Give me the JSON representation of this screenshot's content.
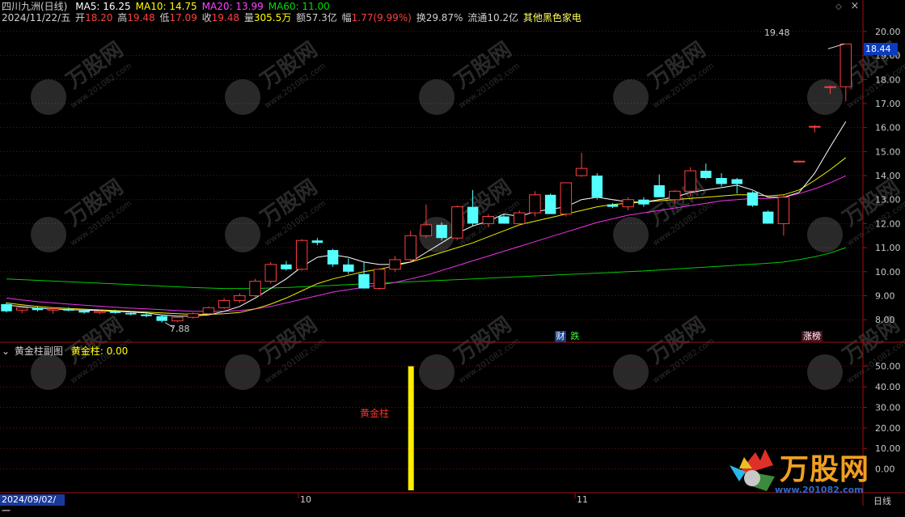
{
  "window": {
    "title": "四川九洲(日线)",
    "period_label": "日线"
  },
  "ma_legend": [
    {
      "label": "MA5: 16.25",
      "color": "#ffffff"
    },
    {
      "label": "MA10: 14.75",
      "color": "#ffff00"
    },
    {
      "label": "MA20: 13.99",
      "color": "#ff44ff"
    },
    {
      "label": "MA60: 11.00",
      "color": "#00dd00"
    }
  ],
  "quote": {
    "date": "2024/11/22/五",
    "open_label": "开",
    "open": "18.20",
    "high_label": "高",
    "high": "19.48",
    "low_label": "低",
    "low": "17.09",
    "close_label": "收",
    "close": "19.48",
    "vol_label": "量",
    "vol": "305.5万",
    "amount_label": "额",
    "amount": "57.3亿",
    "chg_label": "幅",
    "chg": "1.77(9.99%)",
    "turnover_label": "换",
    "turnover": "29.87%",
    "float_label": "流通",
    "float": "10.2亿",
    "sector": "其他黑色家电"
  },
  "price_axis": {
    "min": 7.5,
    "max": 20.3,
    "ticks": [
      "20.00",
      "19.00",
      "18.00",
      "17.00",
      "16.00",
      "15.00",
      "14.00",
      "13.00",
      "12.00",
      "11.00",
      "10.00",
      "9.00",
      "8.00"
    ],
    "current": "18.44",
    "high_note": "19.48",
    "low_note": "7.88"
  },
  "date_axis": {
    "start": "2024/09/02/一",
    "ticks": [
      "10",
      "11"
    ]
  },
  "markers": {
    "cai": "财",
    "die": "跌",
    "zhangting": "涨榜"
  },
  "sub_chart": {
    "title": "黄金柱副图",
    "indicator_label": "黄金柱: 0.00",
    "bar_label": "黄金柱",
    "ticks": [
      "50.00",
      "40.00",
      "30.00",
      "20.00",
      "10.00",
      "0.00"
    ],
    "min": -10,
    "max": 55
  },
  "watermark": {
    "brand": "万股网",
    "url": "www.201082.com"
  },
  "chart_data": {
    "type": "candlestick",
    "ohlc": [
      [
        8.65,
        8.72,
        8.3,
        8.35
      ],
      [
        8.4,
        8.55,
        8.28,
        8.5
      ],
      [
        8.5,
        8.58,
        8.35,
        8.4
      ],
      [
        8.4,
        8.48,
        8.25,
        8.45
      ],
      [
        8.45,
        8.52,
        8.35,
        8.38
      ],
      [
        8.38,
        8.42,
        8.25,
        8.3
      ],
      [
        8.3,
        8.4,
        8.22,
        8.35
      ],
      [
        8.35,
        8.42,
        8.25,
        8.28
      ],
      [
        8.28,
        8.33,
        8.18,
        8.22
      ],
      [
        8.22,
        8.28,
        8.1,
        8.15
      ],
      [
        8.15,
        8.2,
        7.88,
        7.95
      ],
      [
        7.95,
        8.15,
        7.9,
        8.1
      ],
      [
        8.1,
        8.3,
        8.05,
        8.25
      ],
      [
        8.25,
        8.55,
        8.2,
        8.5
      ],
      [
        8.5,
        8.9,
        8.45,
        8.8
      ],
      [
        8.8,
        9.1,
        8.7,
        9.0
      ],
      [
        9.0,
        9.7,
        8.95,
        9.6
      ],
      [
        9.6,
        10.4,
        9.5,
        10.3
      ],
      [
        10.3,
        10.45,
        10.05,
        10.1
      ],
      [
        10.1,
        11.35,
        10.05,
        11.3
      ],
      [
        11.3,
        11.4,
        11.1,
        11.2
      ],
      [
        10.9,
        10.95,
        10.2,
        10.3
      ],
      [
        10.3,
        10.55,
        9.9,
        10.0
      ],
      [
        9.9,
        10.4,
        9.3,
        9.3
      ],
      [
        9.3,
        10.15,
        9.25,
        10.1
      ],
      [
        10.1,
        10.65,
        10.0,
        10.5
      ],
      [
        10.5,
        11.7,
        10.4,
        11.5
      ],
      [
        11.5,
        12.8,
        11.4,
        11.95
      ],
      [
        11.95,
        12.05,
        11.3,
        11.4
      ],
      [
        11.4,
        12.75,
        11.3,
        12.7
      ],
      [
        12.7,
        13.4,
        11.9,
        12.0
      ],
      [
        12.0,
        12.4,
        11.85,
        12.3
      ],
      [
        12.3,
        12.4,
        12.0,
        12.0
      ],
      [
        12.0,
        12.55,
        11.95,
        12.45
      ],
      [
        12.45,
        13.35,
        12.3,
        13.2
      ],
      [
        13.2,
        13.25,
        12.45,
        12.4
      ],
      [
        12.4,
        13.7,
        12.3,
        13.7
      ],
      [
        14.0,
        14.95,
        13.95,
        14.3
      ],
      [
        14.0,
        14.1,
        13.0,
        13.1
      ],
      [
        12.8,
        12.85,
        12.65,
        12.7
      ],
      [
        12.7,
        13.1,
        12.55,
        13.0
      ],
      [
        13.0,
        13.1,
        12.7,
        12.8
      ],
      [
        13.6,
        14.05,
        13.1,
        13.1
      ],
      [
        13.0,
        13.4,
        12.85,
        13.35
      ],
      [
        13.35,
        14.35,
        13.15,
        14.2
      ],
      [
        14.2,
        14.5,
        13.85,
        13.9
      ],
      [
        13.9,
        14.1,
        13.55,
        13.65
      ],
      [
        13.85,
        13.9,
        13.25,
        13.65
      ],
      [
        13.3,
        13.35,
        12.7,
        12.75
      ],
      [
        12.5,
        12.55,
        12.0,
        12.0
      ],
      [
        12.0,
        13.2,
        11.5,
        13.1
      ],
      [
        14.6,
        14.62,
        14.58,
        14.6
      ],
      [
        16.05,
        16.1,
        15.8,
        16.05
      ],
      [
        17.7,
        17.75,
        17.4,
        17.7
      ],
      [
        17.7,
        19.48,
        17.09,
        19.48
      ]
    ],
    "ma5": [
      8.6,
      8.55,
      8.48,
      8.45,
      8.42,
      8.4,
      8.38,
      8.35,
      8.32,
      8.28,
      8.2,
      8.15,
      8.15,
      8.2,
      8.35,
      8.55,
      8.9,
      9.3,
      9.7,
      10.2,
      10.6,
      10.7,
      10.6,
      10.4,
      10.3,
      10.3,
      10.4,
      10.8,
      11.2,
      11.6,
      11.9,
      12.1,
      12.4,
      12.3,
      12.5,
      12.6,
      12.7,
      13.0,
      13.1,
      13.0,
      12.9,
      12.9,
      13.0,
      13.1,
      13.3,
      13.4,
      13.5,
      13.6,
      13.4,
      13.1,
      13.1,
      13.3,
      14.1,
      15.2,
      16.25
    ],
    "ma10": [
      8.7,
      8.62,
      8.55,
      8.5,
      8.47,
      8.44,
      8.41,
      8.38,
      8.35,
      8.32,
      8.28,
      8.25,
      8.22,
      8.22,
      8.25,
      8.3,
      8.45,
      8.65,
      8.9,
      9.2,
      9.5,
      9.7,
      9.85,
      10.0,
      10.1,
      10.25,
      10.4,
      10.6,
      10.8,
      11.0,
      11.2,
      11.45,
      11.7,
      11.95,
      12.1,
      12.25,
      12.4,
      12.55,
      12.7,
      12.8,
      12.85,
      12.9,
      12.95,
      13.0,
      13.05,
      13.1,
      13.15,
      13.2,
      13.2,
      13.15,
      13.2,
      13.4,
      13.8,
      14.25,
      14.75
    ],
    "ma20": [
      8.9,
      8.82,
      8.75,
      8.7,
      8.65,
      8.6,
      8.56,
      8.52,
      8.48,
      8.45,
      8.42,
      8.38,
      8.35,
      8.35,
      8.35,
      8.38,
      8.45,
      8.55,
      8.7,
      8.85,
      9.0,
      9.15,
      9.25,
      9.35,
      9.45,
      9.55,
      9.7,
      9.85,
      10.05,
      10.25,
      10.45,
      10.65,
      10.85,
      11.05,
      11.25,
      11.45,
      11.65,
      11.85,
      12.05,
      12.2,
      12.35,
      12.45,
      12.55,
      12.65,
      12.75,
      12.85,
      12.95,
      13.0,
      13.05,
      13.05,
      13.1,
      13.25,
      13.45,
      13.7,
      13.99
    ],
    "ma60": [
      9.7,
      9.67,
      9.64,
      9.61,
      9.58,
      9.55,
      9.52,
      9.49,
      9.46,
      9.43,
      9.4,
      9.37,
      9.34,
      9.32,
      9.3,
      9.3,
      9.3,
      9.32,
      9.34,
      9.37,
      9.4,
      9.43,
      9.46,
      9.49,
      9.52,
      9.55,
      9.58,
      9.61,
      9.64,
      9.67,
      9.7,
      9.73,
      9.76,
      9.79,
      9.82,
      9.85,
      9.88,
      9.91,
      9.94,
      9.97,
      10.0,
      10.03,
      10.07,
      10.11,
      10.15,
      10.19,
      10.23,
      10.27,
      10.31,
      10.35,
      10.4,
      10.5,
      10.62,
      10.78,
      11.0
    ],
    "gold_bar": {
      "index": 26,
      "value": 50
    }
  }
}
